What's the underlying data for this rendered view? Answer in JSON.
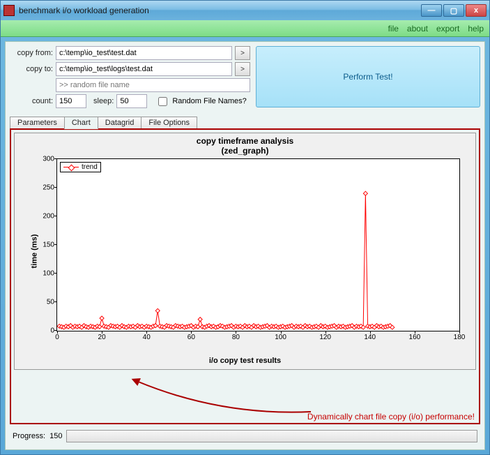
{
  "window": {
    "title": "benchmark i/o workload generation",
    "buttons": {
      "min": "—",
      "max": "▢",
      "close": "x"
    }
  },
  "menu": {
    "file": "file",
    "about": "about",
    "export": "export",
    "help": "help"
  },
  "form": {
    "copy_from_label": "copy from:",
    "copy_from_value": "c:\\temp\\io_test\\test.dat",
    "copy_to_label": "copy to:",
    "copy_to_value": "c:\\temp\\io_test\\logs\\test.dat",
    "random_name_placeholder": ">> random file name",
    "count_label": "count:",
    "count_value": "150",
    "sleep_label": "sleep:",
    "sleep_value": "50",
    "random_chk_label": "Random File Names?",
    "dd_glyph": ">"
  },
  "perform_label": "Perform Test!",
  "tabs": {
    "parameters": "Parameters",
    "chart": "Chart",
    "datagrid": "Datagrid",
    "file_options": "File Options"
  },
  "annotation": "Dynamically chart file copy (i/o) performance!",
  "progress": {
    "label": "Progress:",
    "value": "150"
  },
  "chart_data": {
    "type": "line",
    "title": "copy timeframe analysis",
    "subtitle": "(zed_graph)",
    "series_name": "trend",
    "xlabel": "i/o copy test results",
    "ylabel": "time (ms)",
    "xlim": [
      0,
      180
    ],
    "ylim": [
      0,
      300
    ],
    "xticks": [
      0,
      20,
      40,
      60,
      80,
      100,
      120,
      140,
      160,
      180
    ],
    "yticks": [
      0,
      50,
      100,
      150,
      200,
      250,
      300
    ],
    "series": [
      {
        "name": "trend",
        "x_start": 1,
        "values": [
          8,
          7,
          6,
          8,
          7,
          9,
          6,
          8,
          7,
          8,
          6,
          9,
          7,
          6,
          8,
          7,
          6,
          8,
          7,
          22,
          8,
          7,
          6,
          9,
          8,
          7,
          8,
          6,
          9,
          7,
          6,
          8,
          7,
          8,
          6,
          9,
          7,
          8,
          6,
          8,
          7,
          6,
          8,
          9,
          35,
          8,
          7,
          6,
          9,
          8,
          7,
          6,
          9,
          8,
          7,
          8,
          6,
          7,
          8,
          9,
          6,
          8,
          7,
          20,
          7,
          6,
          8,
          9,
          7,
          8,
          6,
          7,
          9,
          8,
          6,
          7,
          8,
          9,
          6,
          8,
          7,
          8,
          6,
          9,
          7,
          8,
          6,
          9,
          7,
          8,
          6,
          7,
          8,
          9,
          6,
          8,
          7,
          8,
          6,
          7,
          8,
          6,
          7,
          8,
          9,
          6,
          8,
          7,
          8,
          6,
          9,
          7,
          8,
          6,
          7,
          8,
          6,
          9,
          7,
          8,
          6,
          7,
          8,
          9,
          6,
          8,
          7,
          8,
          6,
          7,
          8,
          9,
          6,
          8,
          7,
          8,
          6,
          240,
          8,
          7,
          8,
          6,
          9,
          7,
          8,
          6,
          7,
          8,
          9,
          6
        ]
      }
    ]
  }
}
